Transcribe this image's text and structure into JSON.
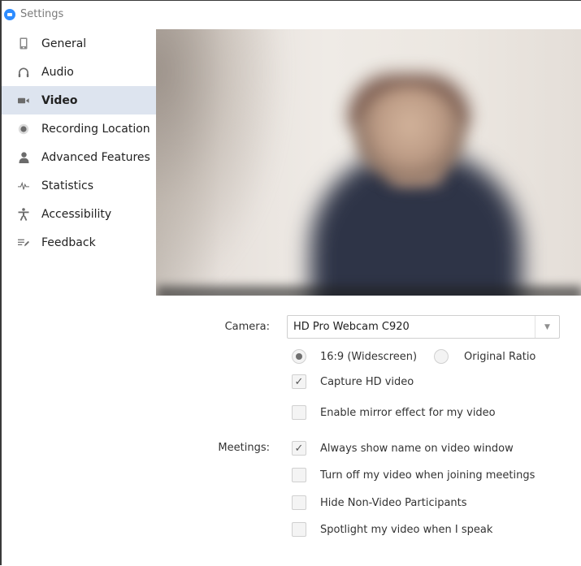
{
  "window": {
    "title": "Settings",
    "logo_icon": "zoom-logo-icon"
  },
  "sidebar": {
    "items": [
      {
        "label": "General",
        "icon": "phone-device-icon",
        "active": false
      },
      {
        "label": "Audio",
        "icon": "headphones-icon",
        "active": false
      },
      {
        "label": "Video",
        "icon": "video-camera-icon",
        "active": true
      },
      {
        "label": "Recording Location",
        "icon": "record-dot-icon",
        "active": false
      },
      {
        "label": "Advanced Features",
        "icon": "user-icon",
        "active": false
      },
      {
        "label": "Statistics",
        "icon": "pulse-icon",
        "active": false
      },
      {
        "label": "Accessibility",
        "icon": "accessibility-icon",
        "active": false
      },
      {
        "label": "Feedback",
        "icon": "feedback-edit-icon",
        "active": false
      }
    ],
    "active_bg": "#dde4ef"
  },
  "video": {
    "camera_label": "Camera:",
    "camera_value": "HD Pro Webcam C920",
    "ratio_options": [
      {
        "label": "16:9 (Widescreen)",
        "selected": true
      },
      {
        "label": "Original Ratio",
        "selected": false
      }
    ],
    "options": [
      {
        "label": "Capture HD video",
        "checked": true
      },
      {
        "label": "Enable mirror effect for my video",
        "checked": false
      }
    ],
    "meetings_label": "Meetings:",
    "meeting_options": [
      {
        "label": "Always show name on video window",
        "checked": true
      },
      {
        "label": "Turn off my video when joining meetings",
        "checked": false
      },
      {
        "label": "Hide Non-Video Participants",
        "checked": false
      },
      {
        "label": "Spotlight my video when I speak",
        "checked": false
      }
    ]
  }
}
